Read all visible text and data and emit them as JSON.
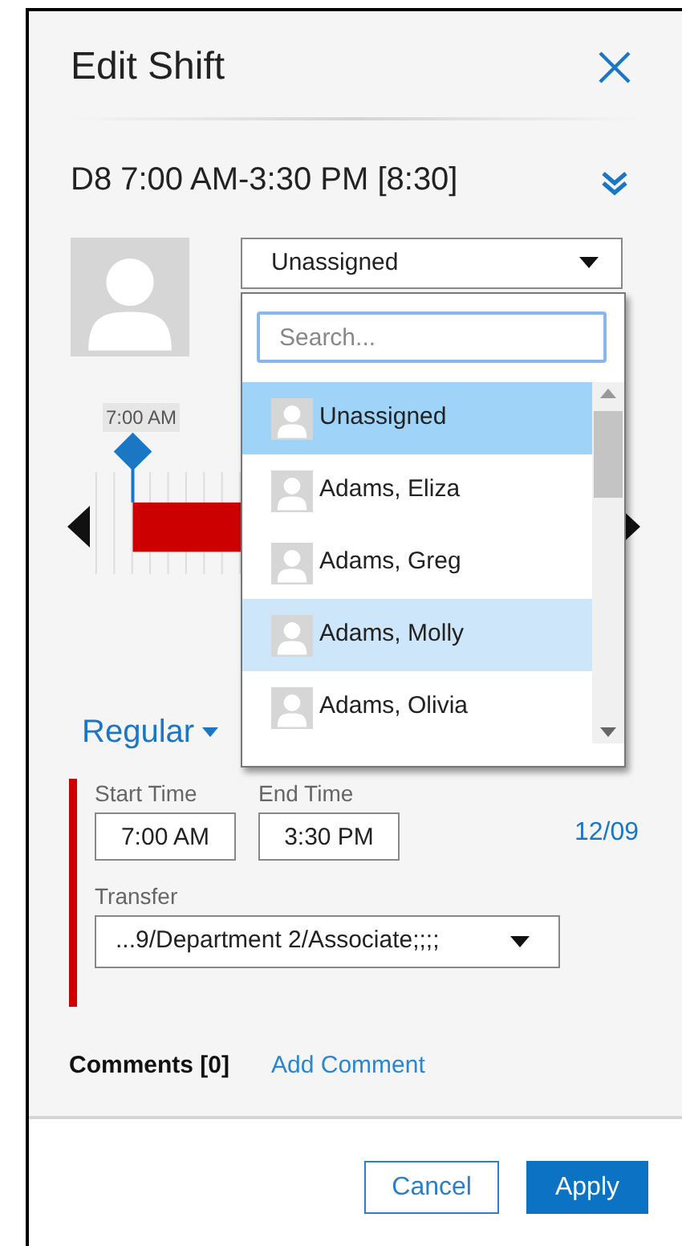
{
  "title": "Edit Shift",
  "shift": "D8 7:00 AM-3:30 PM [8:30]",
  "assignee": {
    "value": "Unassigned",
    "expanded": true
  },
  "dropdown": {
    "placeholder": "Search...",
    "items": [
      {
        "name": "Unassigned",
        "selected": true,
        "hovered": false
      },
      {
        "name": "Adams, Eliza",
        "selected": false,
        "hovered": false
      },
      {
        "name": "Adams, Greg",
        "selected": false,
        "hovered": false
      },
      {
        "name": "Adams, Molly",
        "selected": false,
        "hovered": true
      },
      {
        "name": "Adams, Olivia",
        "selected": false,
        "hovered": false
      }
    ]
  },
  "timeline": {
    "marker_label": "7:00 AM"
  },
  "pay_code": "Regular",
  "start_time": {
    "label": "Start Time",
    "value": "7:00 AM"
  },
  "end_time": {
    "label": "End Time",
    "value": "3:30 PM"
  },
  "date": "12/09",
  "transfer": {
    "label": "Transfer",
    "value": "...9/Department 2/Associate;;;;"
  },
  "comments": {
    "label": "Comments [0]",
    "add_link": "Add Comment"
  },
  "buttons": [
    {
      "label": "Cancel",
      "kind": "secondary"
    },
    {
      "label": "Apply",
      "kind": "primary"
    }
  ]
}
